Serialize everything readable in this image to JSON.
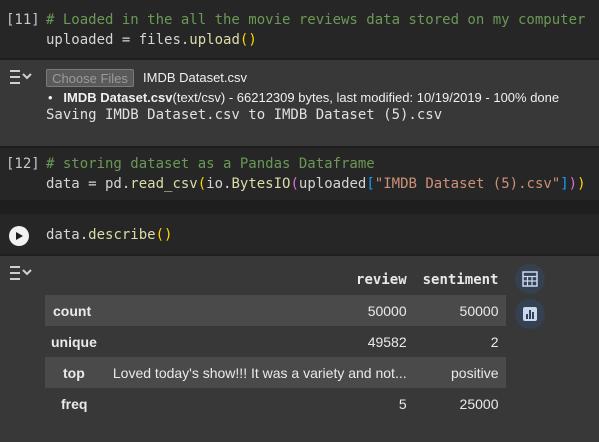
{
  "cells": [
    {
      "exec_count": "[11]",
      "code": {
        "line1_comment": "# Loaded in the all the movie reviews data stored on my computer",
        "line2_var": "uploaded",
        "line2_op": " = files.",
        "line2_fn": "upload",
        "line2_paren_open": "(",
        "line2_paren_close": ")"
      },
      "output": {
        "choose_files_label": "Choose Files",
        "selected_file": "IMDB Dataset.csv",
        "upload_bold": "IMDB Dataset.csv",
        "upload_rest": "(text/csv) - 66212309 bytes, last modified: 10/19/2019 - 100% done",
        "saving_text": "Saving IMDB Dataset.csv to IMDB Dataset (5).csv"
      }
    },
    {
      "exec_count": "[12]",
      "code": {
        "line1_comment": "# storing dataset as a Pandas Dataframe",
        "line2_prefix": "data = pd.",
        "line2_fn": "read_csv",
        "line2_p1": "(",
        "line2_mid": "io.",
        "line2_fn2": "BytesIO",
        "line2_p2": "(",
        "line2_var": "uploaded",
        "line2_b1": "[",
        "line2_str": "\"IMDB Dataset (5).csv\"",
        "line2_b2": "]",
        "line2_p3": ")",
        "line2_p4": ")"
      }
    },
    {
      "code": {
        "prefix": "data.",
        "fn": "describe",
        "paren_open": "(",
        "paren_close": ")"
      },
      "table": {
        "columns": [
          "review",
          "sentiment"
        ],
        "rows": [
          {
            "label": "count",
            "review": "50000",
            "sentiment": "50000"
          },
          {
            "label": "unique",
            "review": "49582",
            "sentiment": "2"
          },
          {
            "label": "top",
            "review": "Loved today's show!!! It was a variety and not...",
            "sentiment": "positive"
          },
          {
            "label": "freq",
            "review": "5",
            "sentiment": "25000"
          }
        ]
      }
    }
  ]
}
